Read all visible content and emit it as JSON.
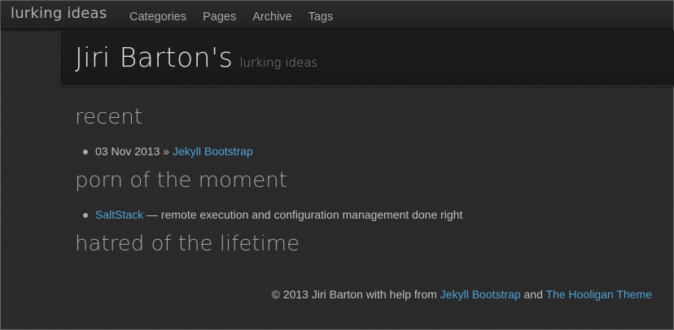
{
  "brand": "lurking ideas",
  "nav": {
    "items": [
      {
        "label": "Categories"
      },
      {
        "label": "Pages"
      },
      {
        "label": "Archive"
      },
      {
        "label": "Tags"
      }
    ]
  },
  "header": {
    "title": "Jiri Barton's",
    "subtitle": "lurking ideas"
  },
  "sections": {
    "recent": {
      "heading": "recent",
      "items": [
        {
          "date": "03 Nov 2013",
          "separator": "»",
          "link": "Jekyll Bootstrap"
        }
      ]
    },
    "porn": {
      "heading": "porn of the moment",
      "items": [
        {
          "link": "SaltStack",
          "text": "— remote execution and configuration management done right"
        }
      ]
    },
    "hatred": {
      "heading": "hatred of the lifetime"
    }
  },
  "footer": {
    "prefix": "© 2013 Jiri Barton with help from",
    "link1": "Jekyll Bootstrap",
    "and": "and",
    "link2": "The Hooligan Theme"
  },
  "colors": {
    "link": "#4fa3d9",
    "background": "#2a2a2a",
    "header_background": "#1b1b1b"
  }
}
